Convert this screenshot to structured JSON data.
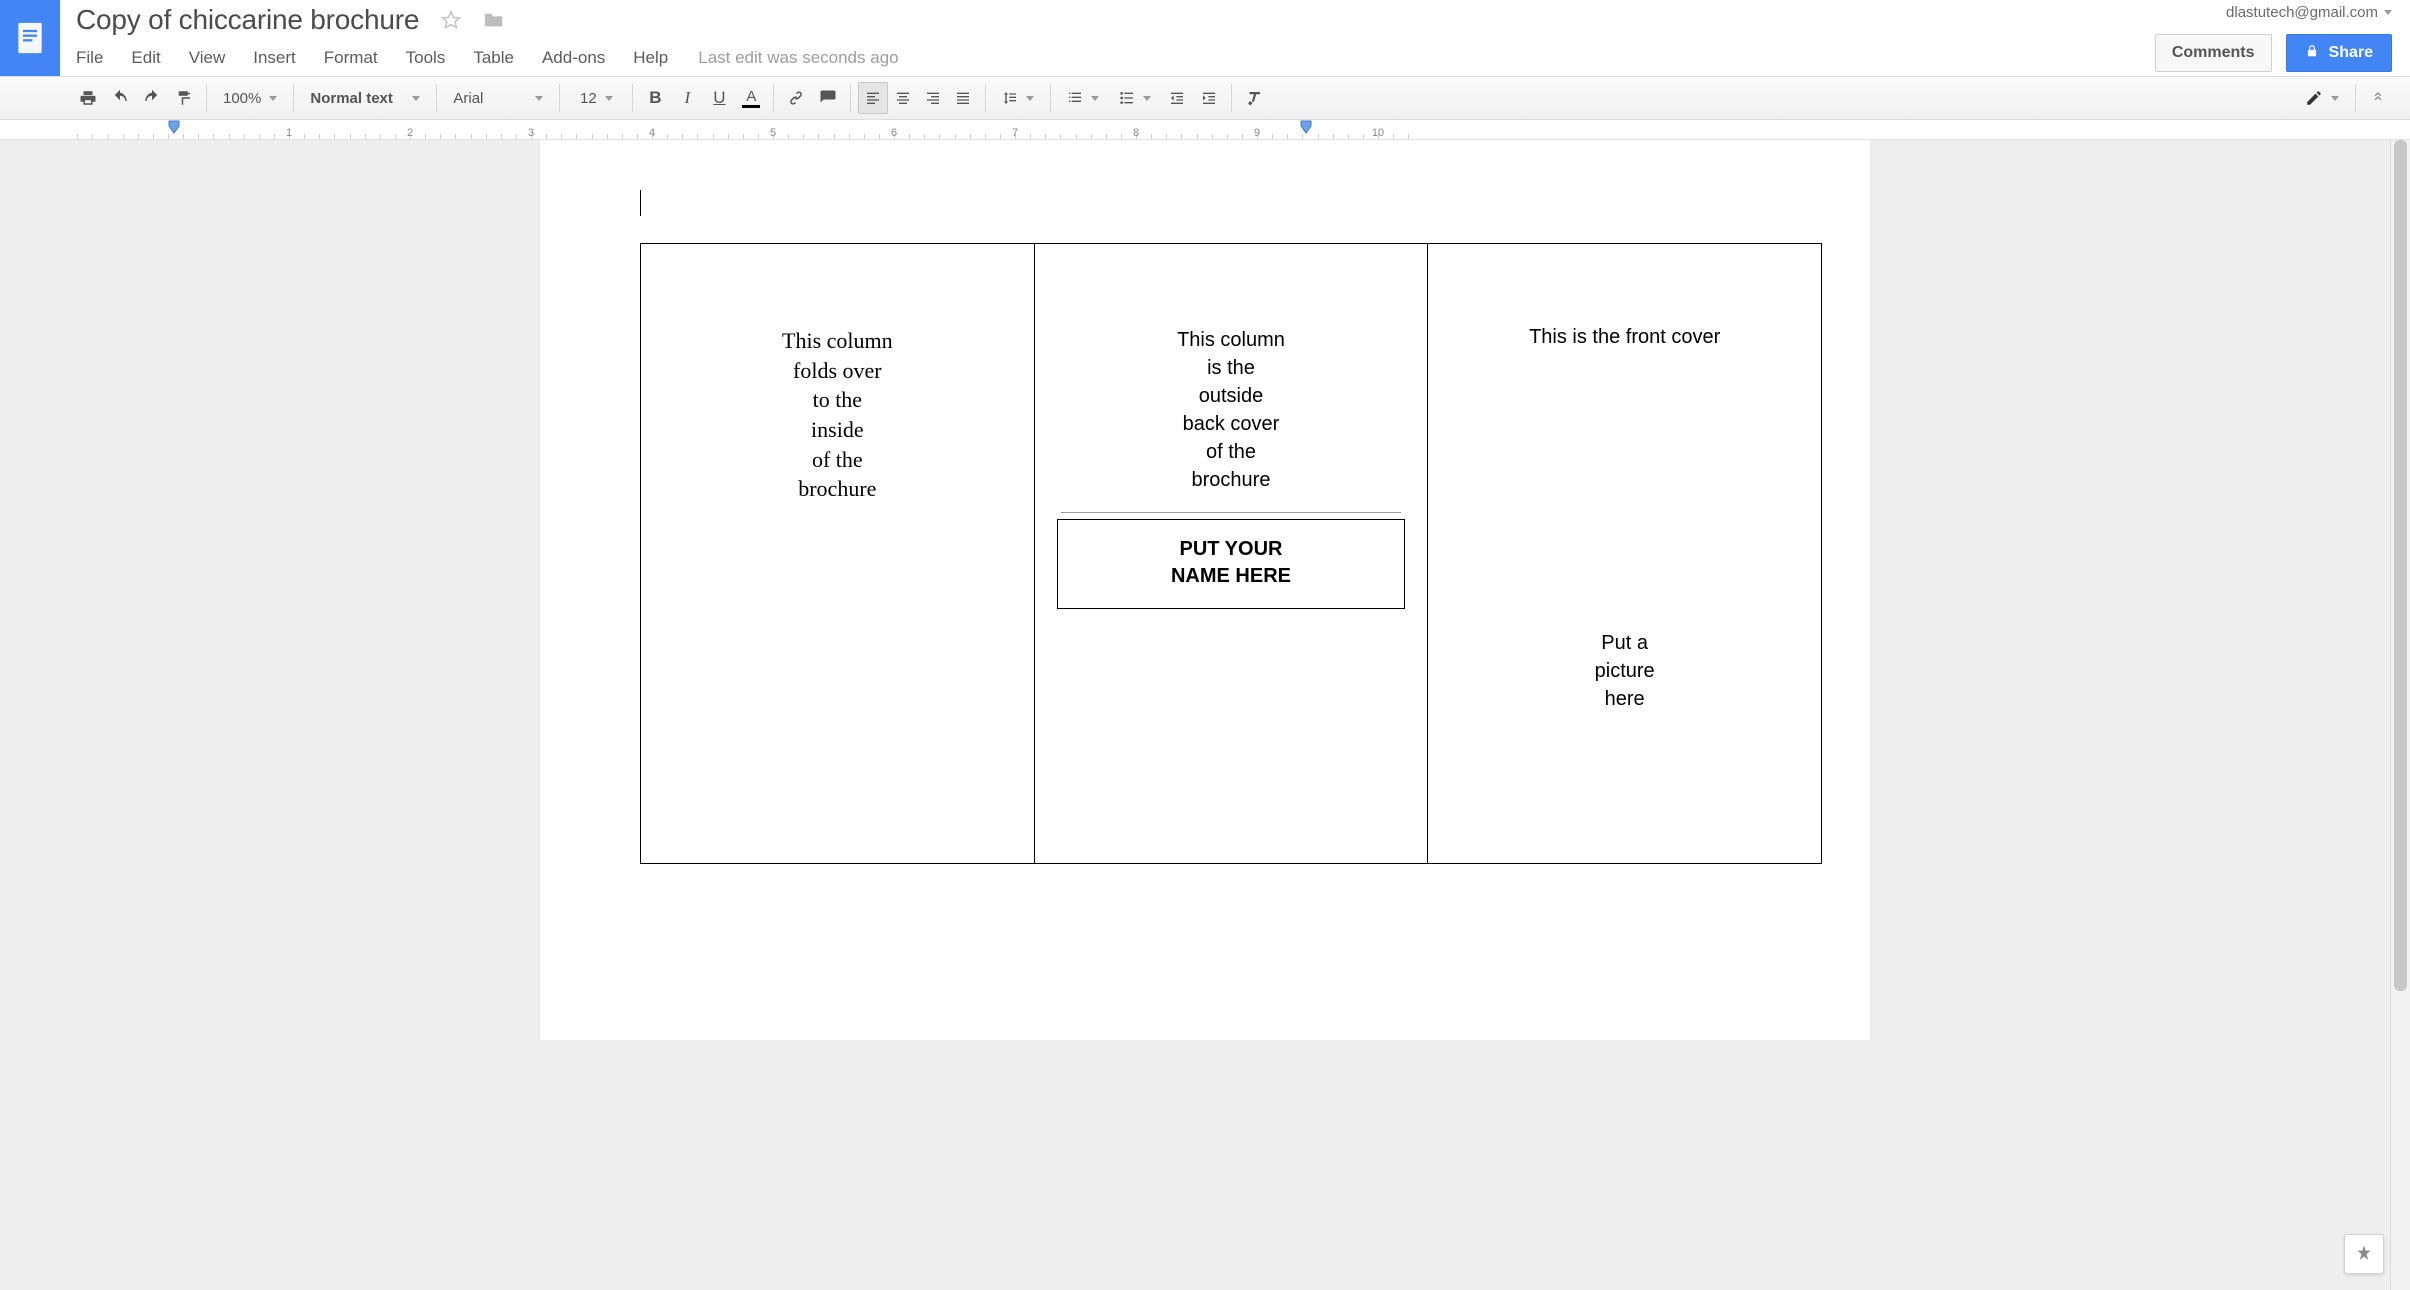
{
  "account_email": "dlastutech@gmail.com",
  "doc_title": "Copy of chiccarine brochure",
  "menus": [
    "File",
    "Edit",
    "View",
    "Insert",
    "Format",
    "Tools",
    "Table",
    "Add-ons",
    "Help"
  ],
  "last_edit": "Last edit was seconds ago",
  "buttons": {
    "comments": "Comments",
    "share": "Share"
  },
  "toolbar": {
    "zoom": "100%",
    "style": "Normal text",
    "font": "Arial",
    "size": "12"
  },
  "ruler": {
    "majors": [
      "1",
      "2",
      "3",
      "4",
      "5",
      "6",
      "7",
      "8",
      "9",
      "10"
    ]
  },
  "doc": {
    "col1": "This column\nfolds over\nto the\ninside\nof the\nbrochure",
    "col2_top": "This column\nis the\noutside\nback cover\nof the\nbrochure",
    "col2_namebox": "PUT YOUR\nNAME HERE",
    "col3_head": "This is the front cover",
    "col3_picture": "Put a\npicture\nhere"
  }
}
